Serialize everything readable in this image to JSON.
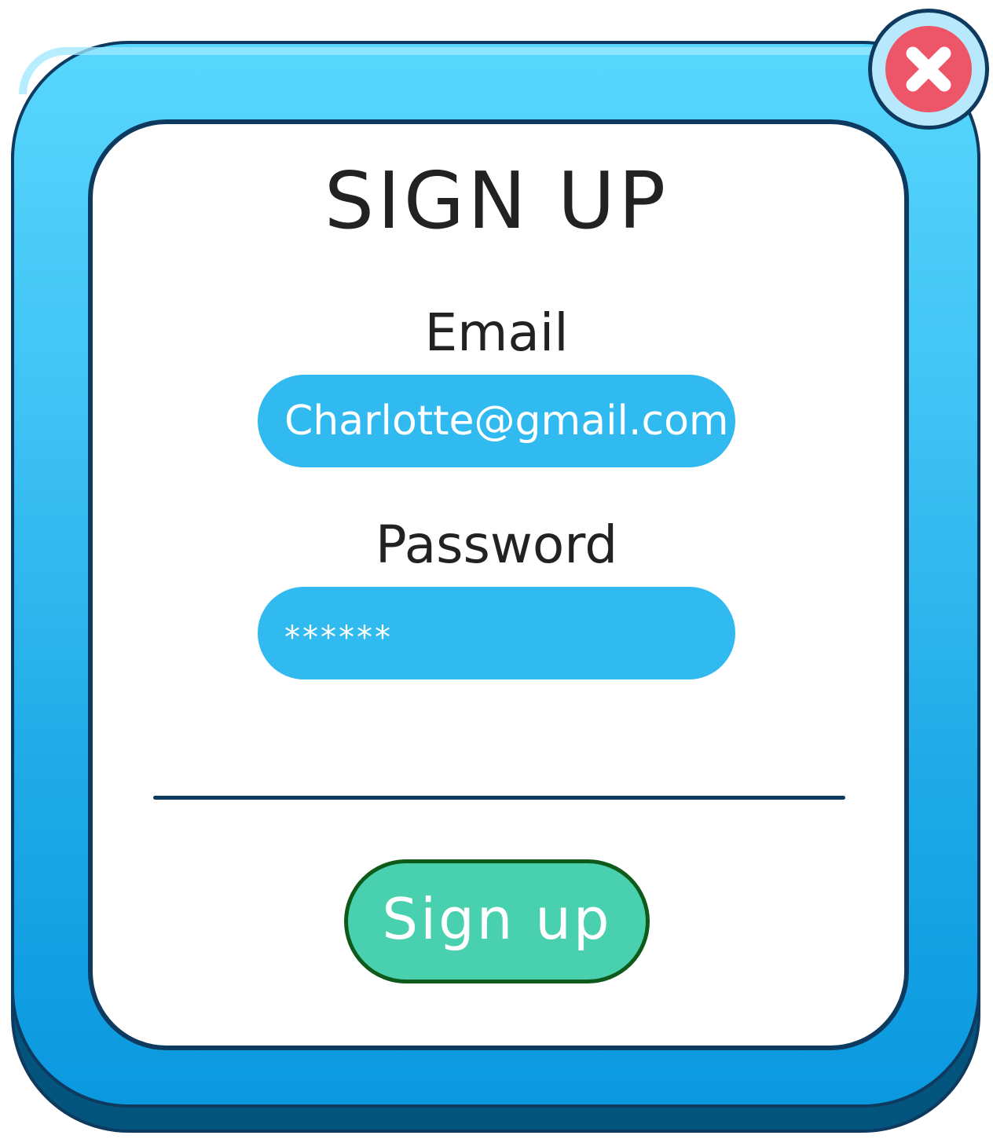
{
  "dialog": {
    "title": "SIGN UP",
    "email_label": "Email",
    "email_value": "Charlotte@gmail.com",
    "password_label": "Password",
    "password_value": "******",
    "submit_label": "Sign up",
    "close_icon": "close-icon"
  },
  "colors": {
    "frame": "#3fc2f4",
    "outline": "#0d3a5e",
    "field": "#31baef",
    "button": "#49d0ae",
    "close": "#ed5568"
  }
}
